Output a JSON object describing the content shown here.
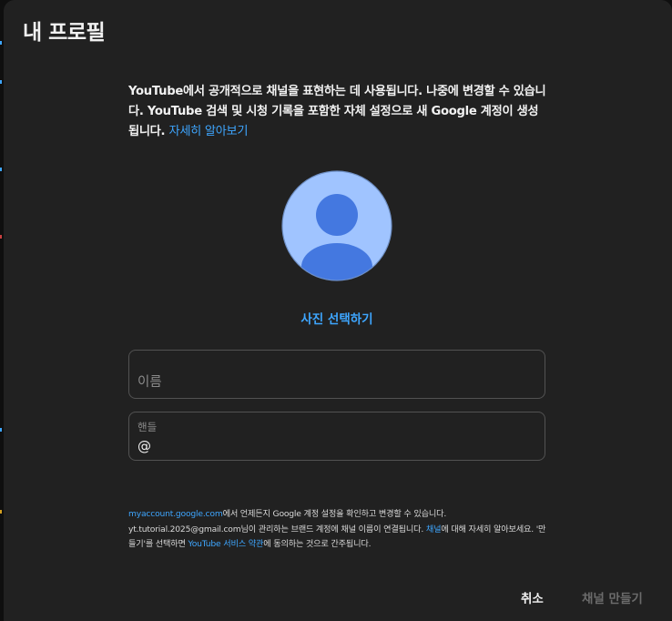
{
  "dialog": {
    "title": "내 프로필",
    "description": {
      "text": "YouTube에서 공개적으로 채널을 표현하는 데 사용됩니다. 나중에 변경할 수 있습니다. YouTube 검색 및 시청 기록을 포함한 자체 설정으로 새 Google 계정이 생성됩니다. ",
      "learn_more": "자세히 알아보기"
    },
    "avatar_icon": "default-avatar-icon",
    "choose_photo_label": "사진 선택하기",
    "name_field": {
      "placeholder": "이름",
      "value": ""
    },
    "handle_field": {
      "label": "핸들",
      "prefix": "@",
      "value": ""
    },
    "footer": {
      "account_link": "myaccount.google.com",
      "text_1": "에서 언제든지 Google 계정 설정을 확인하고 변경할 수 있습니다. ",
      "email": "yt.tutorial.2025@gmail.com",
      "text_2": "님이 관리하는 브랜드 계정에 채널 이름이 연결됩니다. ",
      "channel_link": "채널",
      "text_3": "에 대해 자세히 알아보세요. '만들기'를 선택하면 ",
      "terms_link": "YouTube 서비스 약관",
      "text_4": "에 동의하는 것으로 간주됩니다."
    },
    "buttons": {
      "cancel": "취소",
      "create": "채널 만들기"
    }
  },
  "colors": {
    "background": "#212121",
    "text_primary": "#f1f1f1",
    "link": "#3ea6ff",
    "avatar_light": "#a0c4ff",
    "avatar_dark": "#4478e0",
    "disabled": "#6b6b6b"
  }
}
